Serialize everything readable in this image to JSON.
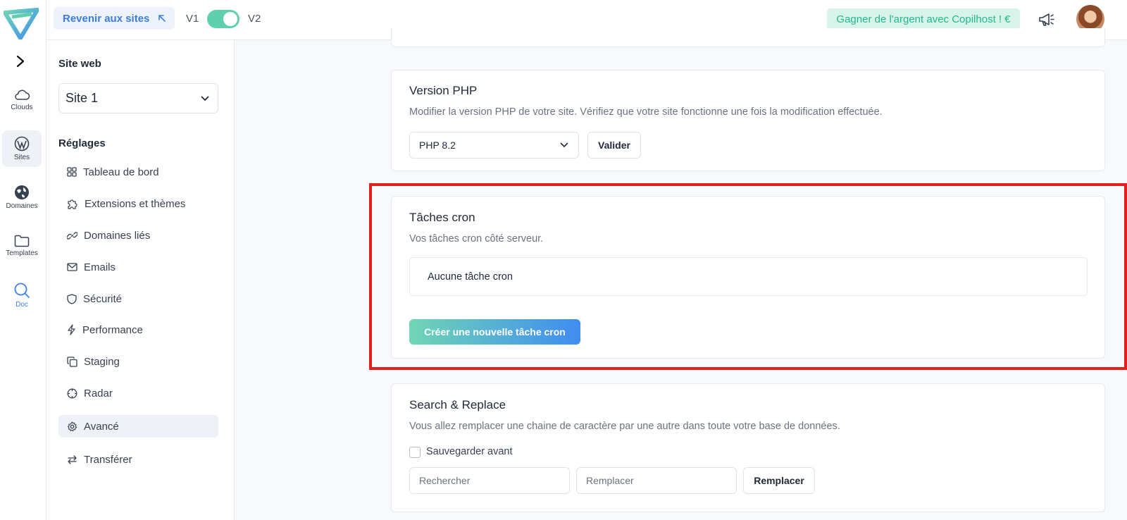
{
  "topbar": {
    "back_label": "Revenir aux sites",
    "v1_label": "V1",
    "v2_label": "V2",
    "version_toggle_on": true,
    "earn_label": "Gagner de l'argent avec Copilhost ! €"
  },
  "rail": {
    "items": [
      {
        "label": "Clouds",
        "icon": "cloud-icon"
      },
      {
        "label": "Sites",
        "icon": "wordpress-icon"
      },
      {
        "label": "Domaines",
        "icon": "globe-icon"
      },
      {
        "label": "Templates",
        "icon": "folder-icon"
      },
      {
        "label": "Doc",
        "icon": "search-icon"
      }
    ]
  },
  "sidebar": {
    "site_label": "Site web",
    "site_value": "Site 1",
    "settings_label": "Réglages",
    "items": [
      {
        "label": "Tableau de bord",
        "icon": "dashboard-icon"
      },
      {
        "label": "Extensions et thèmes",
        "icon": "puzzle-icon"
      },
      {
        "label": "Domaines liés",
        "icon": "link-icon"
      },
      {
        "label": "Emails",
        "icon": "mail-icon"
      },
      {
        "label": "Sécurité",
        "icon": "shield-icon"
      },
      {
        "label": "Performance",
        "icon": "lightning-icon"
      },
      {
        "label": "Staging",
        "icon": "copy-icon"
      },
      {
        "label": "Radar",
        "icon": "radar-icon"
      },
      {
        "label": "Avancé",
        "icon": "gear-icon"
      },
      {
        "label": "Transférer",
        "icon": "transfer-icon"
      }
    ],
    "active_item": "Avancé"
  },
  "php": {
    "title": "Version PHP",
    "description": "Modifier la version PHP de votre site. Vérifiez que votre site fonctionne une fois la modification effectuée.",
    "selected": "PHP 8.2",
    "submit_label": "Valider"
  },
  "cron": {
    "title": "Tâches cron",
    "description": "Vos tâches cron côté serveur.",
    "empty_text": "Aucune tâche cron",
    "create_label": "Créer une nouvelle tâche cron"
  },
  "search_replace": {
    "title": "Search & Replace",
    "description": "Vous allez remplacer une chaine de caractère par une autre dans toute votre base de données.",
    "backup_label": "Sauvegarder avant",
    "backup_checked": false,
    "search_placeholder": "Rechercher",
    "replace_placeholder": "Remplacer",
    "replace_button": "Remplacer"
  },
  "colors": {
    "accent_blue": "#3b7de0",
    "accent_green": "#5fd0ae",
    "highlight_red": "#e0201c"
  }
}
